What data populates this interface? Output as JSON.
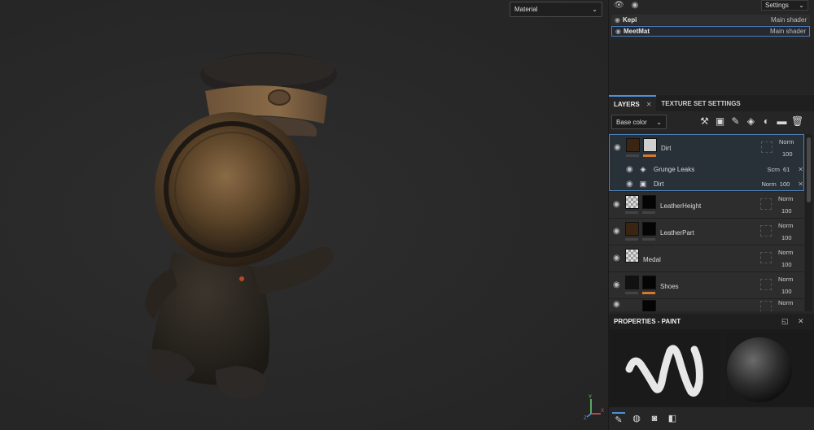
{
  "viewport": {
    "mode_select": "Material",
    "gizmo": {
      "x_label": "X",
      "y_label": "Y",
      "z_label": "Z"
    }
  },
  "texture_sets": {
    "settings_label": "Settings",
    "rows": [
      {
        "name": "Kepi",
        "shader": "Main shader"
      },
      {
        "name": "MeetMat",
        "shader": "Main shader"
      }
    ]
  },
  "layers_panel": {
    "tabs": [
      {
        "label": "LAYERS"
      },
      {
        "label": "TEXTURE SET SETTINGS"
      }
    ],
    "channel": "Base color",
    "group": {
      "name": "Dirt",
      "blend": "Norm",
      "opacity": "100",
      "effects": [
        {
          "name": "Grunge Leaks",
          "blend": "Scrn",
          "opacity": "61"
        },
        {
          "name": "Dirt",
          "blend": "Norm",
          "opacity": "100"
        }
      ]
    },
    "layers": [
      {
        "name": "LeatherHeight",
        "blend": "Norm",
        "opacity": "100"
      },
      {
        "name": "LeatherPart",
        "blend": "Norm",
        "opacity": "100"
      },
      {
        "name": "Medal",
        "blend": "Norm",
        "opacity": "100"
      },
      {
        "name": "Shoes",
        "blend": "Norm",
        "opacity": "100"
      },
      {
        "name": "",
        "blend": "Norm",
        "opacity": ""
      }
    ]
  },
  "properties": {
    "title": "PROPERTIES - PAINT"
  },
  "colors": {
    "accent": "#4d8fd6",
    "orange": "#d27a2c"
  }
}
